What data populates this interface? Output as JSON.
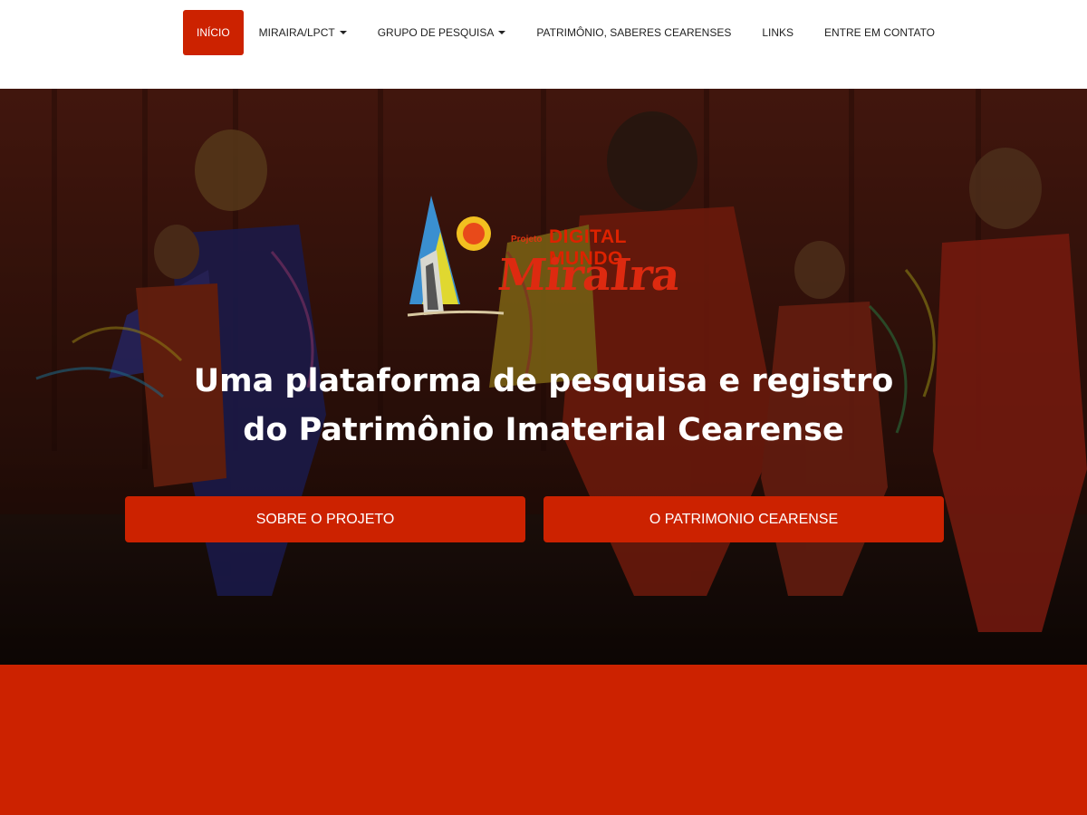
{
  "nav": {
    "items": [
      {
        "label": "INÍCIO",
        "active": true,
        "dropdown": false
      },
      {
        "label": "MIRAIRA/LPCT",
        "active": false,
        "dropdown": true
      },
      {
        "label": "GRUPO DE PESQUISA",
        "active": false,
        "dropdown": true
      },
      {
        "label": "PATRIMÔNIO, SABERES CEARENSES",
        "active": false,
        "dropdown": false
      },
      {
        "label": "LINKS",
        "active": false,
        "dropdown": false
      },
      {
        "label": "ENTRE EM CONTATO",
        "active": false,
        "dropdown": false
      }
    ]
  },
  "logo": {
    "small": "Projeto",
    "digital": "DIGITAL MUNDO",
    "name": "MiraIra"
  },
  "hero": {
    "headline_line1": "Uma plataforma de pesquisa e registro",
    "headline_line2": "do Patrimônio Imaterial Cearense",
    "button_left": "SOBRE O PROJETO",
    "button_right": "O PATRIMONIO CEARENSE"
  },
  "colors": {
    "accent": "#cc2200",
    "nav_text": "#222222",
    "hero_text": "#ffffff"
  }
}
